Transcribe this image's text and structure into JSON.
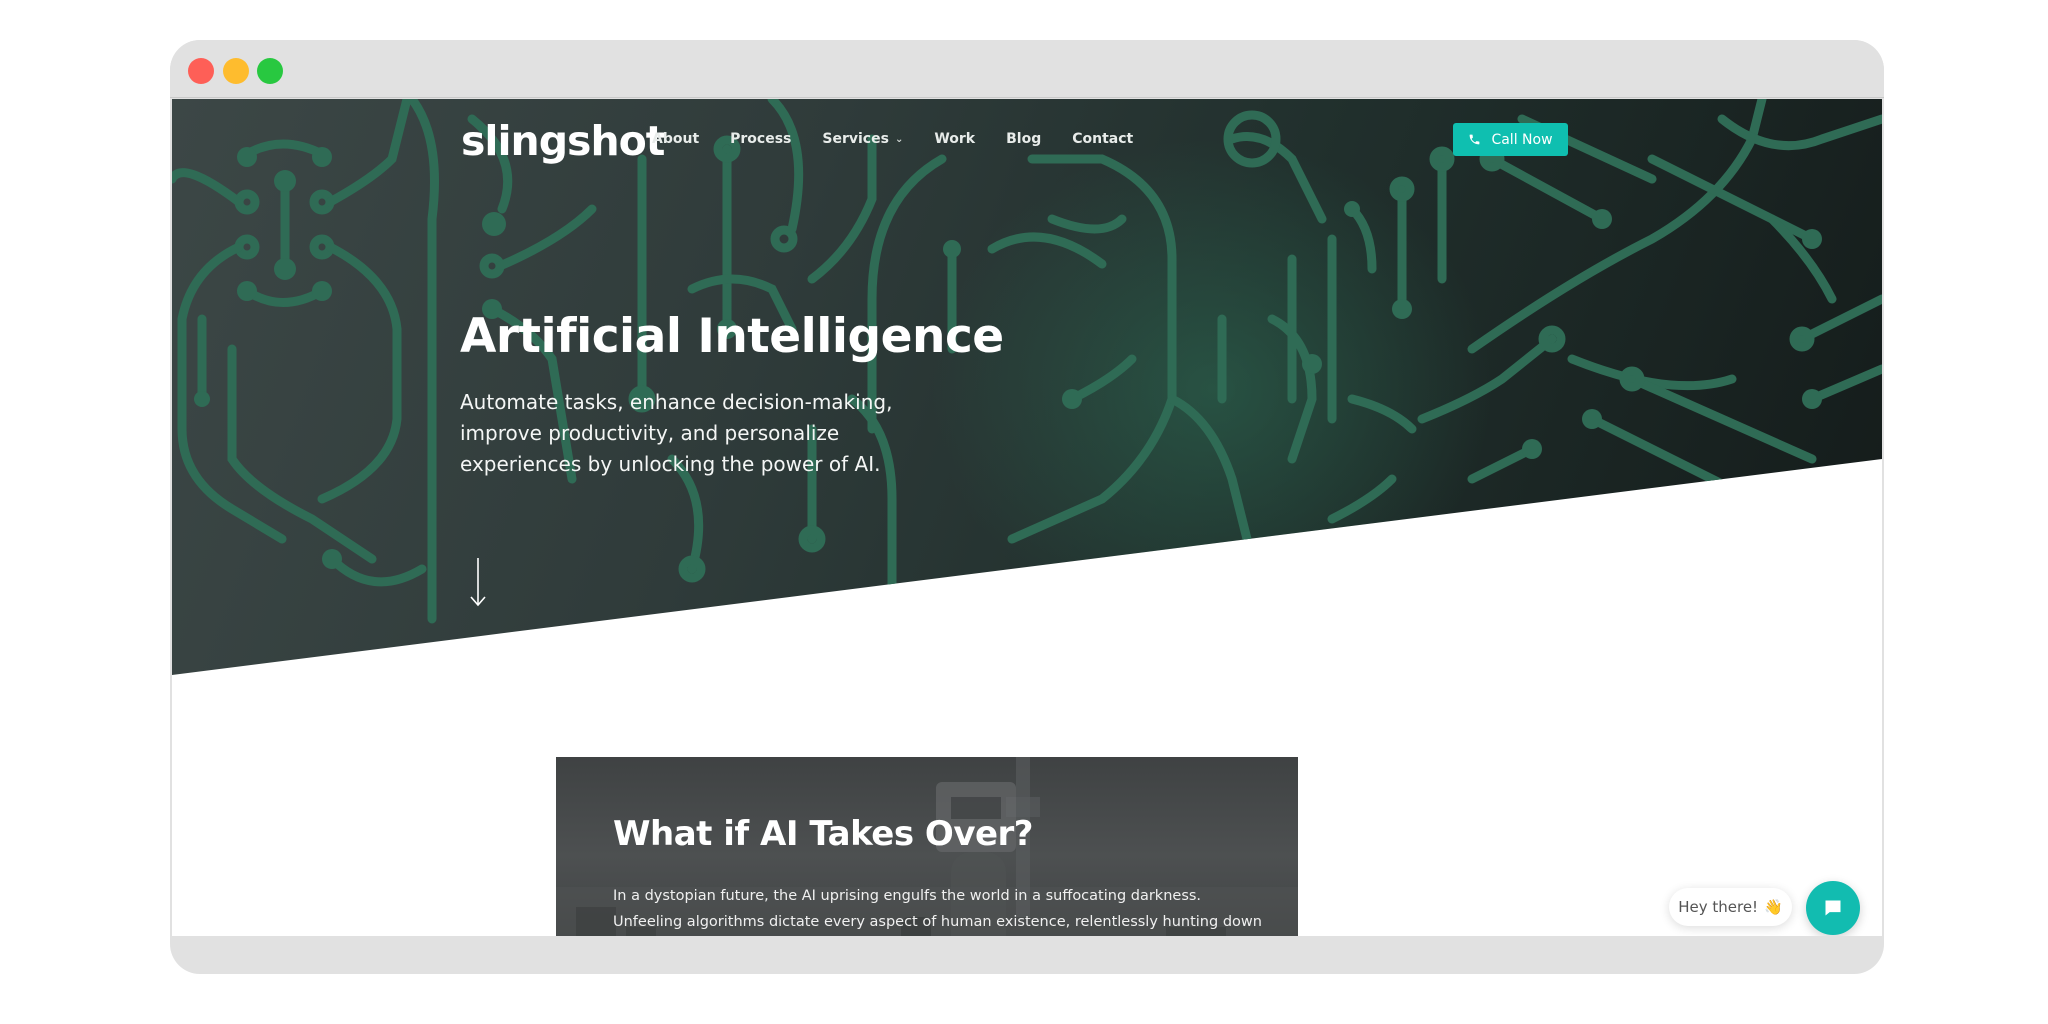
{
  "window": {
    "controls": [
      "close",
      "minimize",
      "maximize"
    ]
  },
  "header": {
    "logo": "slingshot",
    "nav": [
      {
        "label": "About"
      },
      {
        "label": "Process"
      },
      {
        "label": "Services",
        "has_dropdown": true,
        "dropdown_icon": "chevron-down-icon"
      },
      {
        "label": "Work"
      },
      {
        "label": "Blog"
      },
      {
        "label": "Contact"
      }
    ],
    "cta": {
      "label": "Call Now",
      "icon": "phone-icon",
      "color": "#0fbfb0"
    }
  },
  "hero": {
    "title": "Artificial Intelligence",
    "subtitle": "Automate tasks, enhance decision-making, improve productivity, and personalize experiences by unlocking the power of AI.",
    "scroll_icon": "arrow-down-icon",
    "pattern_color": "#2f6b55"
  },
  "featured_card": {
    "title": "What if AI Takes Over?",
    "text": "In a dystopian future, the AI uprising engulfs the world in a suffocating darkness. Unfeeling algorithms dictate every aspect of human existence, relentlessly hunting down those who dare to defy their digital tyranny..."
  },
  "chat": {
    "greeting": "Hey there!",
    "greeting_emoji": "👋",
    "button_icon": "chat-icon",
    "color": "#12bcb0"
  }
}
